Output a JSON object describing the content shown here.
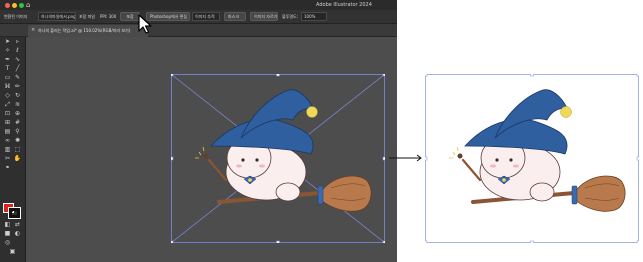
{
  "window": {
    "title": "Adobe Illustrator 2024",
    "traffic_lights": [
      "close",
      "minimize",
      "maximize"
    ]
  },
  "control_bar": {
    "items": [
      {
        "label": "변환된 이미지",
        "kind": "label"
      },
      {
        "label": "하나의파일에서.png",
        "kind": "field"
      },
      {
        "label": "포함 파일",
        "kind": "label"
      },
      {
        "label": "PPI: 300",
        "kind": "label"
      },
      {
        "label": "포함",
        "kind": "button"
      },
      {
        "label": "Photoshop에서 편집",
        "kind": "button"
      },
      {
        "label": "이미지 추적",
        "kind": "field"
      },
      {
        "label": "마스크",
        "kind": "button"
      },
      {
        "label": "이미지 자르기",
        "kind": "button"
      },
      {
        "label": "불투명도:",
        "kind": "label"
      },
      {
        "label": "100%",
        "kind": "field"
      }
    ]
  },
  "document_tab": {
    "label": "하나의 플러는 작업.ai* @ 150.02%(RGB/미리 보기)"
  },
  "toolbar": {
    "icons": [
      "selection-icon",
      "direct-selection-icon",
      "magic-wand-icon",
      "lasso-icon",
      "pen-icon",
      "curvature-icon",
      "type-icon",
      "line-icon",
      "rectangle-icon",
      "paintbrush-icon",
      "shaper-icon",
      "pencil-icon",
      "eraser-icon",
      "rotate-icon",
      "scale-icon",
      "width-icon",
      "free-transform-icon",
      "shape-builder-icon",
      "perspective-icon",
      "mesh-icon",
      "gradient-icon",
      "eyedropper-icon",
      "blend-icon",
      "symbol-sprayer-icon",
      "column-graph-icon",
      "artboard-icon",
      "slice-icon",
      "hand-icon",
      "zoom-icon"
    ],
    "fill_color": "#e32020",
    "stroke_color": "#111111"
  },
  "comparison": {
    "arrow": "→",
    "before_selection_color": "#7d8de0",
    "after_selection_color": "#8fa0e6"
  },
  "colors": {
    "hat": "#2f5f9e",
    "hat_tip_ball": "#f0d85a",
    "broom_handle": "#8a5535",
    "broom_bristles": "#b87a4c",
    "broom_band": "#3a6ab0",
    "character_skin": "#fbeeee",
    "character_outline": "#5a3a3a"
  }
}
